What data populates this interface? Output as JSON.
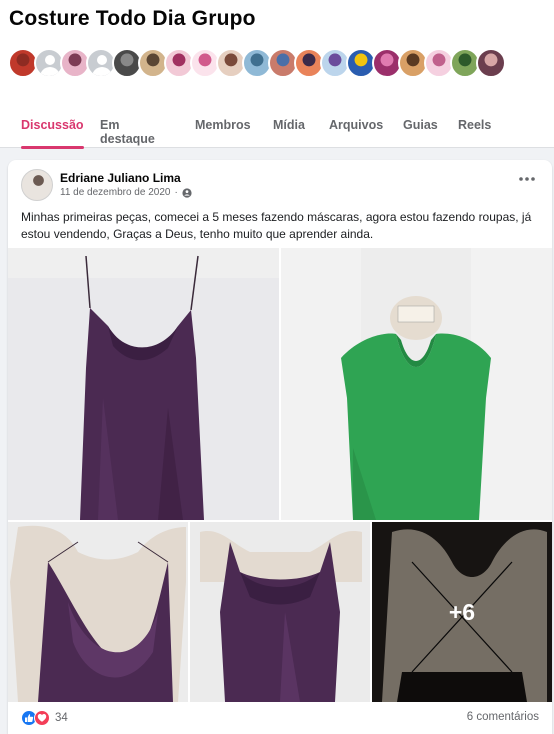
{
  "group": {
    "name": "Costure Todo Dia Grupo",
    "member_avatars": [
      "member-avatar-red",
      "placeholder",
      "member-avatar-pink",
      "placeholder",
      "member-avatar-dark",
      "member-avatar-man",
      "member-avatar-pink2",
      "member-avatar-logo",
      "member-avatar-woman",
      "member-avatar-beach",
      "member-avatar-family",
      "member-avatar-sunset",
      "member-avatar-sky",
      "member-avatar-blue-badge",
      "member-avatar-purple",
      "member-avatar-woman2",
      "member-avatar-script",
      "member-avatar-green",
      "member-avatar-woman3"
    ]
  },
  "tabs": [
    {
      "label": "Discussão",
      "active": true
    },
    {
      "label": "Em destaque",
      "active": false
    },
    {
      "label": "Membros",
      "active": false
    },
    {
      "label": "Mídia",
      "active": false
    },
    {
      "label": "Arquivos",
      "active": false
    },
    {
      "label": "Guias",
      "active": false
    },
    {
      "label": "Reels",
      "active": false
    }
  ],
  "post": {
    "author": "Edriane Juliano Lima",
    "date": "11 de dezembro de 2020",
    "text": "Minhas primeiras peças, comecei a 5 meses fazendo máscaras, agora estou fazendo roupas, já estou vendendo, Graças a Deus, tenho muito que aprender ainda.",
    "more_photos": "+6",
    "reaction_count": "34",
    "comments": "6 comentários"
  },
  "colors": {
    "accent": "#d9376e",
    "like_blue": "#1877f2",
    "love_red": "#f33e58",
    "purple_dress": "#4b2a52",
    "green_top": "#2fa453"
  }
}
